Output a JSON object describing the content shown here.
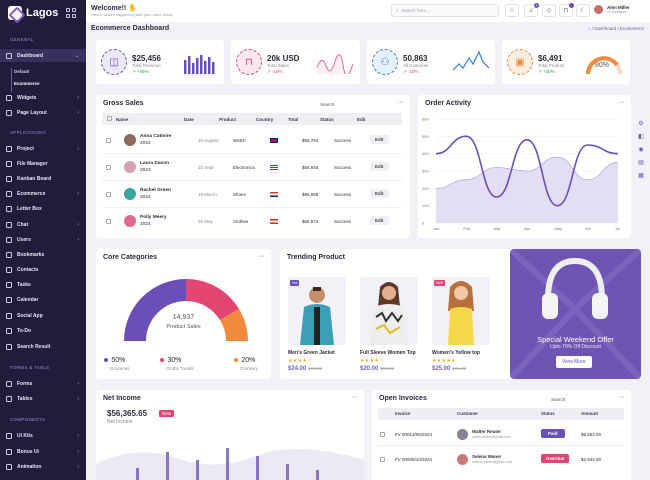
{
  "app": {
    "name": "Lagos"
  },
  "sidebar": {
    "sections": {
      "general": "GENERAL",
      "applications": "APPLICATIONS",
      "forms": "FORMS & TABLE",
      "components": "COMPONENTS"
    },
    "dashboard": "Dashboard",
    "sub_default": "Default",
    "sub_ecommerce": "Ecommerce",
    "items": [
      "Widgets",
      "Page Layout",
      "Project",
      "File Manager",
      "Kanban Board",
      "Ecommerce",
      "Letter Box",
      "Chat",
      "Users",
      "Bookmarks",
      "Contacts",
      "Tasks",
      "Calendar",
      "Social App",
      "To-Do",
      "Search Result"
    ],
    "form_items": [
      "Forms",
      "Tables"
    ],
    "comp_items": [
      "Ui Kits",
      "Bonus Ui",
      "Animation"
    ]
  },
  "topbar": {
    "welcome": "Welcome!!",
    "welcome_sub": "Here's what's happening with your store today",
    "search_placeholder": "Search here...",
    "notif_count": "4",
    "user_name": "Alen Miller",
    "user_role": "UI Designer"
  },
  "page": {
    "title": "Ecommerce Dashboard",
    "crumb_1": "Dashboard",
    "crumb_2": "Ecommerce"
  },
  "stats": [
    {
      "value": "$25,456",
      "label": "Total Revenue",
      "change": "+45%",
      "color": "#6b4fb8",
      "bg": "#ece8f8",
      "icon": "wallet-icon"
    },
    {
      "value": "20k USD",
      "label": "Total Sales",
      "change": "-10%",
      "color": "#e34572",
      "bg": "#fde8ef",
      "icon": "cart-icon"
    },
    {
      "value": "50,863",
      "label": "All Customer",
      "change": "-10%",
      "color": "#3a7bd5",
      "bg": "#e6f0fb",
      "icon": "users-icon"
    },
    {
      "value": "$6,491",
      "label": "Total Product",
      "change": "+30%",
      "color": "#f08a3c",
      "bg": "#fdeee2",
      "icon": "box-icon"
    }
  ],
  "product_gauge": "80%",
  "gross": {
    "title": "Gross Sales",
    "search_label": "Search",
    "headers": [
      "Name",
      "Date",
      "Product",
      "Country",
      "Total",
      "Status",
      "Edit"
    ],
    "rows": [
      {
        "name": "Anna Catmire",
        "year": "2024",
        "date": "10 August",
        "product": "Watch",
        "total": "$56,764",
        "status": "Success",
        "edit": "Edit"
      },
      {
        "name": "Laura Dason",
        "year": "2024",
        "date": "15 Sept",
        "product": "Electronics",
        "total": "$56,845",
        "status": "Success",
        "edit": "Edit"
      },
      {
        "name": "Rachel Green",
        "year": "2024",
        "date": "18 March",
        "product": "Shoes",
        "total": "$96,658",
        "status": "Success",
        "edit": "Edit"
      },
      {
        "name": "Polly Meery",
        "year": "2024",
        "date": "25 May",
        "product": "Clothes",
        "total": "$65,874",
        "status": "Success",
        "edit": "Edit"
      }
    ]
  },
  "order_activity": {
    "title": "Order Activity"
  },
  "chart_data": {
    "type": "area",
    "title": "Order Activity",
    "categories": [
      "Jan",
      "Feb",
      "Mar",
      "Apr",
      "May",
      "Jun",
      "Jul"
    ],
    "ylim": [
      0,
      600
    ],
    "yticks": [
      "0",
      "100",
      "200",
      "300",
      "400",
      "500",
      "600"
    ],
    "series": [
      {
        "values": [
          400,
          500,
          150,
          480,
          100,
          450,
          400
        ]
      },
      {
        "values": [
          200,
          250,
          320,
          300,
          380,
          250,
          350
        ]
      }
    ]
  },
  "categories": {
    "title": "Core Categories",
    "center_value": "14,937",
    "center_label": "Product Sales",
    "legend": [
      {
        "pct": "50%",
        "label": "Groceries",
        "color": "#6b4fb8"
      },
      {
        "pct": "30%",
        "label": "Cloths Trends",
        "color": "#e34572"
      },
      {
        "pct": "20%",
        "label": "Crockery",
        "color": "#f08a3c"
      }
    ]
  },
  "trending": {
    "title": "Trending Product",
    "items": [
      {
        "name": "Men's Green Jacket",
        "stars": "★★★★☆",
        "price": "$24.00",
        "old": "$30.00",
        "tag": "Hot"
      },
      {
        "name": "Full Sleeve Women Top",
        "stars": "★★★★☆",
        "price": "$20.00",
        "old": "$55.00",
        "tag": ""
      },
      {
        "name": "Women's Yellow top",
        "stars": "★★★★★",
        "price": "$25.00",
        "old": "$35.00",
        "tag": "50%"
      }
    ]
  },
  "promo": {
    "title": "Special Weekend Offer",
    "sub": "Upto 70% Off Discount",
    "button": "View More"
  },
  "net_income": {
    "title": "Net Income",
    "value": "$56,365.65",
    "badge": "New",
    "label": "Net Income"
  },
  "invoices": {
    "title": "Open Invoices",
    "search_label": "Search",
    "headers": [
      "Invoice",
      "Customer",
      "Status",
      "Amount"
    ],
    "rows": [
      {
        "invoice": "FV 00012/05/2024",
        "name": "Walter Reuter",
        "email": "walter.reuter@gmail.com",
        "status": "Paid",
        "amount": "$5,654.00"
      },
      {
        "invoice": "FV 00009/10/2024",
        "name": "Selena Waner",
        "email": "selena.waner@gmail.com",
        "status": "Overdue",
        "amount": "$2,942.00"
      }
    ]
  }
}
